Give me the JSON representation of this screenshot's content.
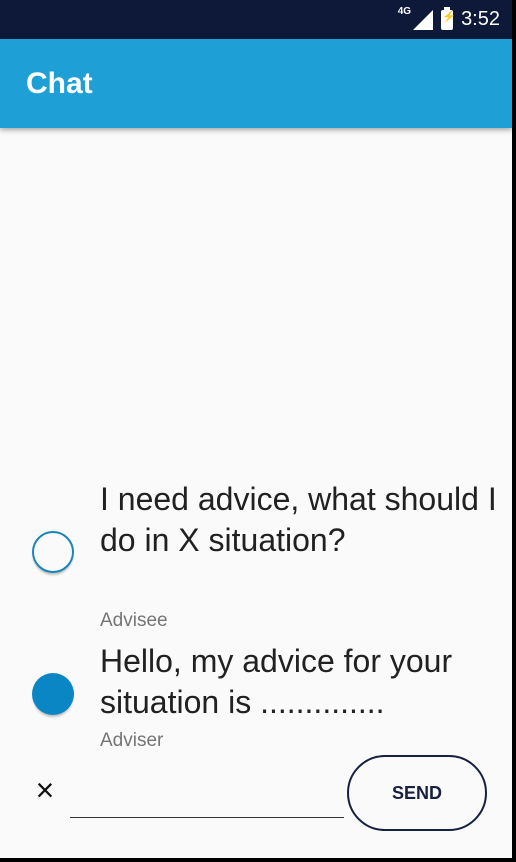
{
  "status_bar": {
    "network": "4G",
    "icons": [
      "signal-icon",
      "battery-charging-icon"
    ],
    "time": "3:52"
  },
  "app_bar": {
    "title": "Chat",
    "color": "#1e9fd6"
  },
  "messages": [
    {
      "text": "I need advice, what should I do in X situation?",
      "sender": "Advisee",
      "avatar": "empty-circle"
    },
    {
      "text": "Hello, my advice for your situation is ..............",
      "sender": "Adviser",
      "avatar": "filled-circle"
    }
  ],
  "composer": {
    "clear_label": "×",
    "input_value": "",
    "input_placeholder": "",
    "send_label": "SEND"
  }
}
